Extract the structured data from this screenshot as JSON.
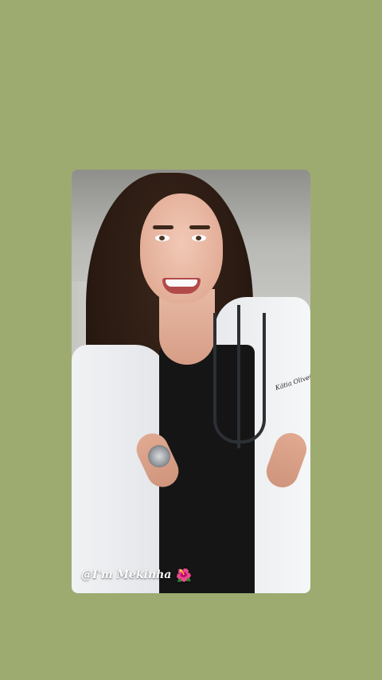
{
  "story": {
    "coat_embroidery": "Kátia Oliveira",
    "mention": {
      "handle": "@I'm Mekinha",
      "emoji": "🌺",
      "emoji_name": "hibiscus-icon"
    }
  },
  "colors": {
    "background": "#9dab71"
  }
}
